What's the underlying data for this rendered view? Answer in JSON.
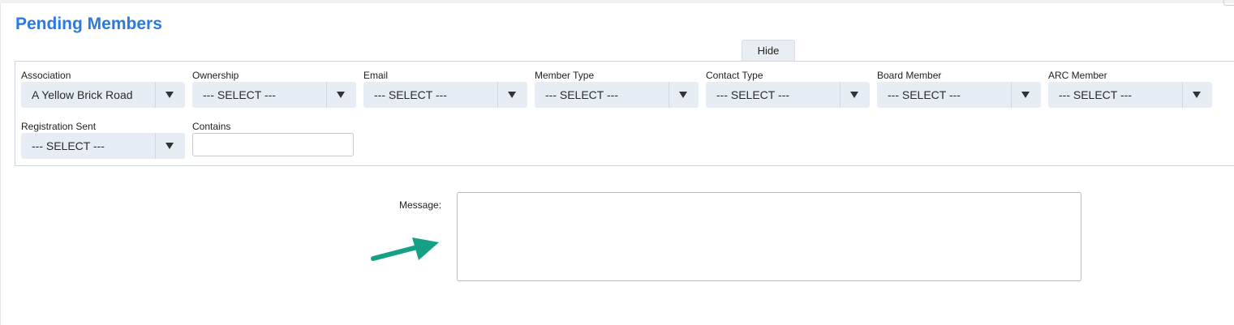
{
  "page": {
    "title": "Pending Members"
  },
  "panel_toggle": {
    "label": "Hide"
  },
  "filters": {
    "association": {
      "label": "Association",
      "value": "A Yellow Brick Road"
    },
    "ownership": {
      "label": "Ownership",
      "value": "--- SELECT ---"
    },
    "email": {
      "label": "Email",
      "value": "--- SELECT ---"
    },
    "member_type": {
      "label": "Member Type",
      "value": "--- SELECT ---"
    },
    "contact_type": {
      "label": "Contact Type",
      "value": "--- SELECT ---"
    },
    "board_member": {
      "label": "Board Member",
      "value": "--- SELECT ---"
    },
    "arc_member": {
      "label": "ARC Member",
      "value": "--- SELECT ---"
    },
    "registration_sent": {
      "label": "Registration Sent",
      "value": "--- SELECT ---"
    },
    "contains": {
      "label": "Contains",
      "value": "",
      "placeholder": ""
    }
  },
  "message": {
    "label": "Message:",
    "value": ""
  },
  "annotation": {
    "icon": "arrow-right-icon",
    "color": "#16a085"
  },
  "colors": {
    "title": "#2a7ae2",
    "select_bg": "#e7edf4",
    "tab_bg": "#e9eef4"
  }
}
